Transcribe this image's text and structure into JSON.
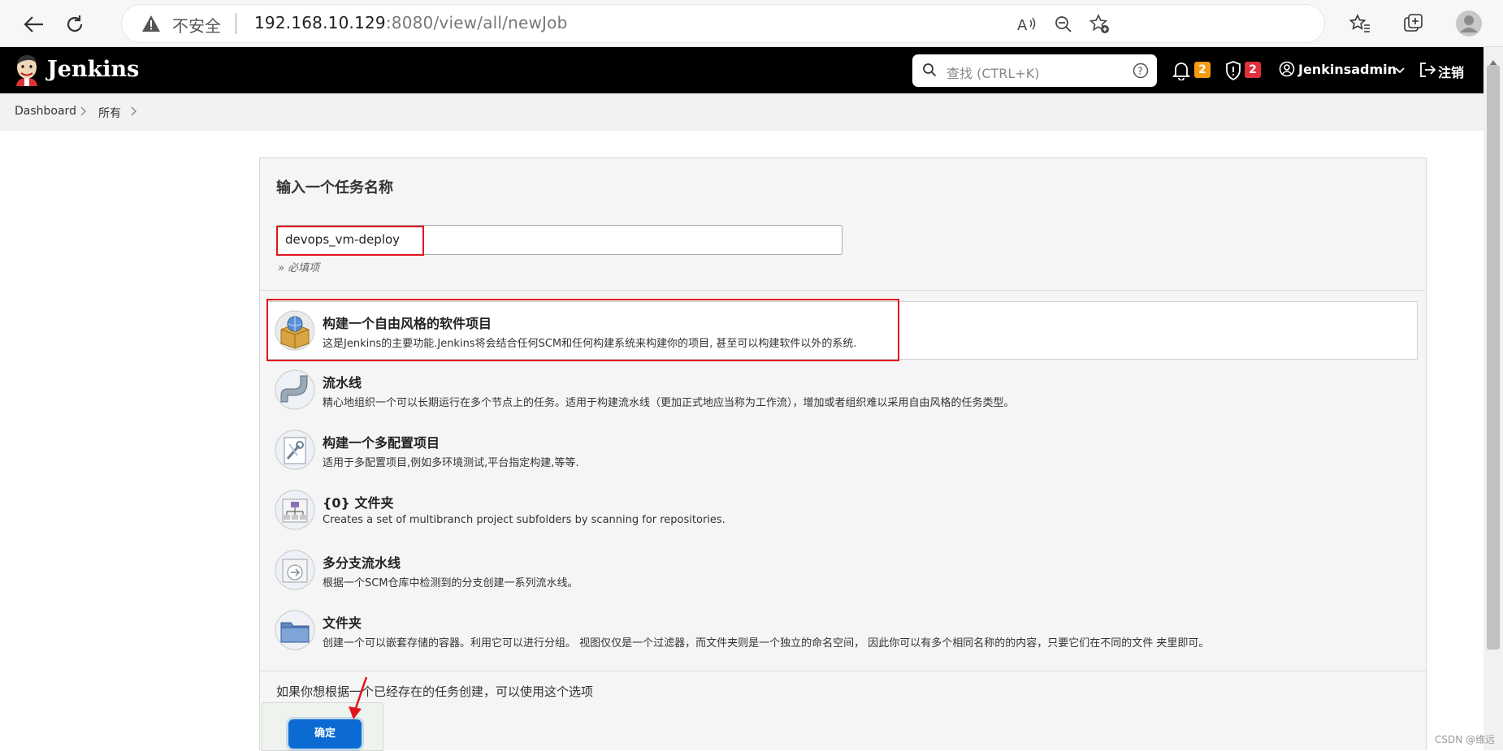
{
  "browser": {
    "security_label": "不安全",
    "url_host": "192.168.10.129",
    "url_rest": ":8080/view/all/newJob"
  },
  "header": {
    "brand": "Jenkins",
    "search_placeholder": "查找 (CTRL+K)",
    "notifications_count": "2",
    "security_count": "2",
    "user": "Jenkinsadmin",
    "logout": "注销"
  },
  "breadcrumb": {
    "items": [
      "Dashboard",
      "所有"
    ]
  },
  "form": {
    "name_label": "输入一个任务名称",
    "name_value": "devops_vm-deploy",
    "required_hint": "» 必填项",
    "copy_label": "如果你想根据一个已经存在的任务创建，可以使用这个选项",
    "ok_label": "确定"
  },
  "item_types": [
    {
      "title": "构建一个自由风格的软件项目",
      "desc": "这是Jenkins的主要功能.Jenkins将会结合任何SCM和任何构建系统来构建你的项目, 甚至可以构建软件以外的系统.",
      "icon": "freestyle-icon",
      "selected": true
    },
    {
      "title": "流水线",
      "desc": "精心地组织一个可以长期运行在多个节点上的任务。适用于构建流水线（更加正式地应当称为工作流），增加或者组织难以采用自由风格的任务类型。",
      "icon": "pipeline-icon",
      "selected": false
    },
    {
      "title": "构建一个多配置项目",
      "desc": "适用于多配置项目,例如多环境测试,平台指定构建,等等.",
      "icon": "multi-config-icon",
      "selected": false
    },
    {
      "title": "{0} 文件夹",
      "desc": "Creates a set of multibranch project subfolders by scanning for repositories.",
      "icon": "org-folder-icon",
      "selected": false
    },
    {
      "title": "多分支流水线",
      "desc": "根据一个SCM仓库中检测到的分支创建一系列流水线。",
      "icon": "multibranch-icon",
      "selected": false
    },
    {
      "title": "文件夹",
      "desc": "创建一个可以嵌套存储的容器。利用它可以进行分组。 视图仅仅是一个过滤器，而文件夹则是一个独立的命名空间， 因此你可以有多个相同名称的的内容，只要它们在不同的文件 夹里即可。",
      "icon": "folder-icon",
      "selected": false
    }
  ],
  "colors": {
    "header_bg": "#000000",
    "accent_blue": "#0b6bd3",
    "badge_orange": "#f39c12",
    "badge_red": "#e0313b",
    "annotation_red": "#e0161f"
  },
  "watermark": "CSDN @维远"
}
